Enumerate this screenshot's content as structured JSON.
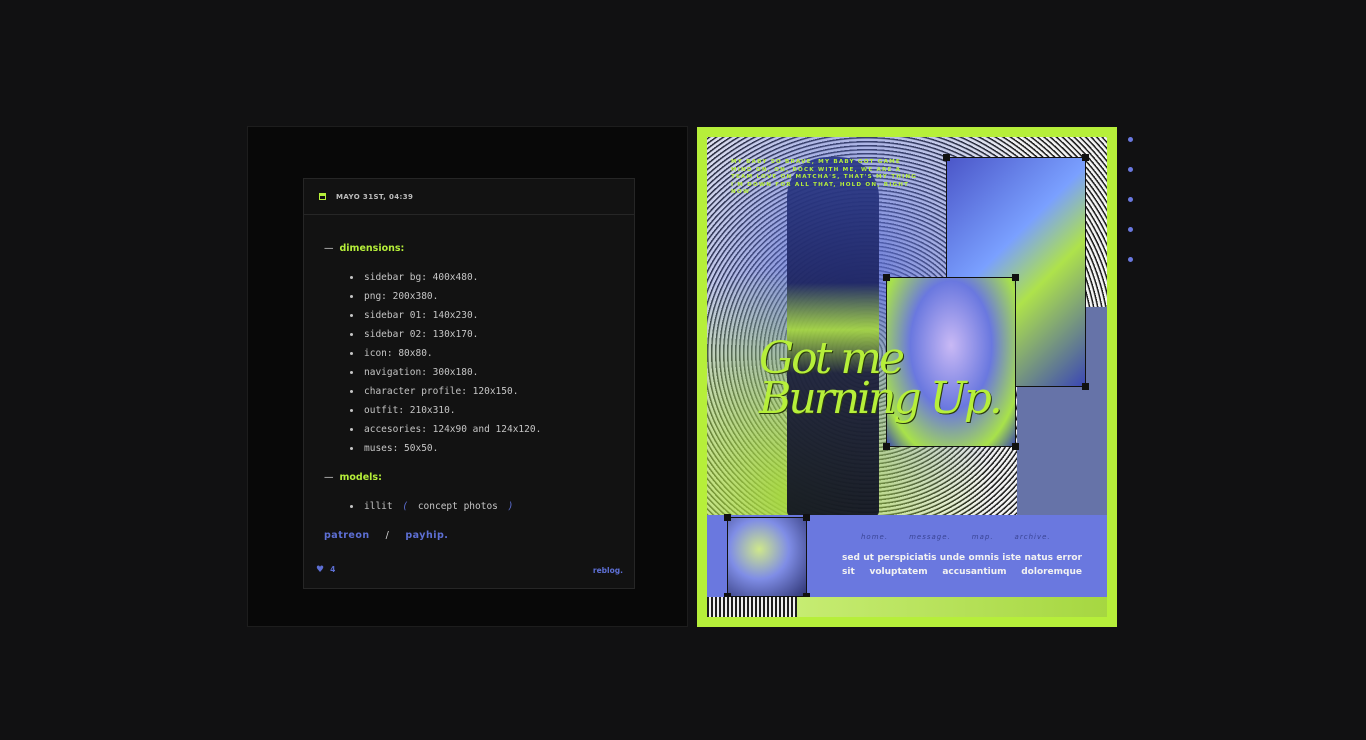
{
  "post": {
    "date": "MAYO 31ST, 04:39",
    "sections": {
      "dimensions": {
        "title": "dimensions:",
        "items": [
          "sidebar bg: 400x480.",
          "png: 200x380.",
          "sidebar 01: 140x230.",
          "sidebar 02: 130x170.",
          "icon: 80x80.",
          "navigation: 300x180.",
          "character profile: 120x150.",
          "outfit: 210x310.",
          "accesories: 124x90 and 124x120.",
          "muses: 50x50."
        ]
      },
      "models": {
        "title": "models:",
        "item_name": "illit",
        "paren_open": "(",
        "item_note": "concept photos",
        "paren_close": ")"
      }
    },
    "links": {
      "patreon": "patreon",
      "separator": "/",
      "payhip": "payhip."
    },
    "footer": {
      "likes": "4",
      "reblog": "reblog."
    }
  },
  "graphic": {
    "tiny_text": "MY BABY SO BRAVE, MY BABY GOT GAME MIND ON, ON, ROCK WITH ME, WE ARE A TEAM LOVE ON MATCHA'S, THAT'S MY THING I'M DOWN FOR ALL THAT, HOLD ON, RIGHT NOW",
    "title_line1": "Got me",
    "title_line2": "Burning Up.",
    "nav": [
      "home.",
      "message.",
      "map.",
      "archive."
    ],
    "blurb": "sed ut perspiciatis unde omnis iste natus error sit voluptatem accusantium doloremque"
  },
  "colors": {
    "lime": "#b6ef3a",
    "periwinkle": "#6a78df",
    "link_blue": "#5d6fd4",
    "background": "#111112"
  },
  "icons": {
    "date": "calendar-icon",
    "likes": "heart-icon"
  }
}
